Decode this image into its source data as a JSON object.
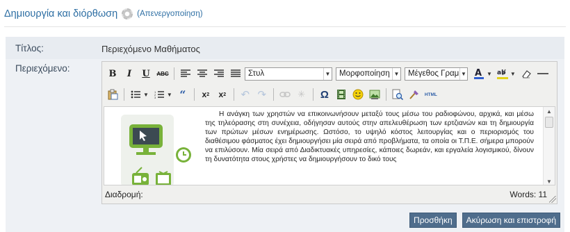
{
  "header": {
    "title": "Δημιουργία και διόρθωση",
    "icon": "gear-icon",
    "deactivate_link": "(Απενεργοποίηση)"
  },
  "form": {
    "title_label": "Τίτλος:",
    "title_value": "Περιεχόμενο Μαθήματος",
    "content_label": "Περιεχόμενο:"
  },
  "editor": {
    "toolbar_row1": {
      "bold": "B",
      "italic": "I",
      "underline": "U",
      "strikethrough": "ABC",
      "style_select": "Στυλ",
      "format_select": "Μορφοποίηση",
      "font_size_select": "Μέγεθος Γραμμ"
    },
    "toolbar_row2": {
      "html_button": "HTML"
    },
    "content_text": "Η ανάγκη των χρηστών να επικοινωνήσουν μεταξύ τους μέσω του ραδιοφώνου, αρχικά, και μέσω της τηλεόρασης στη συνέχεια, οδήγησαν αυτούς στην απελευθέρωση των ερτζιανών και τη δημιουργία των πρώτων μέσων ενημέρωσης. Ωστόσο, το υψηλό κόστος λειτουργίας και ο περιορισμός του διαθέσιμου φάσματος έχει δημιουργήσει μία σειρά από προβλήματα, τα οποία οι Τ.Π.Ε. σήμερα μπορούν να επιλύσουν. Μία σειρά από Διαδικτυακές υπηρεσίες, κάποιες δωρεάν, και εργαλεία λογισμικού, δίνουν τη δυνατότητα στους χρήστες να δημιουργήσουν το δικό τους",
    "status_path": "Διαδρομή:",
    "word_count": "Words: 11"
  },
  "actions": {
    "add": "Προσθήκη",
    "cancel": "Ακύρωση και επιστροφή"
  },
  "colors": {
    "link_blue": "#2d6ea3",
    "button_bg": "#4f6d8c",
    "panel_bg": "#eef1f5"
  }
}
